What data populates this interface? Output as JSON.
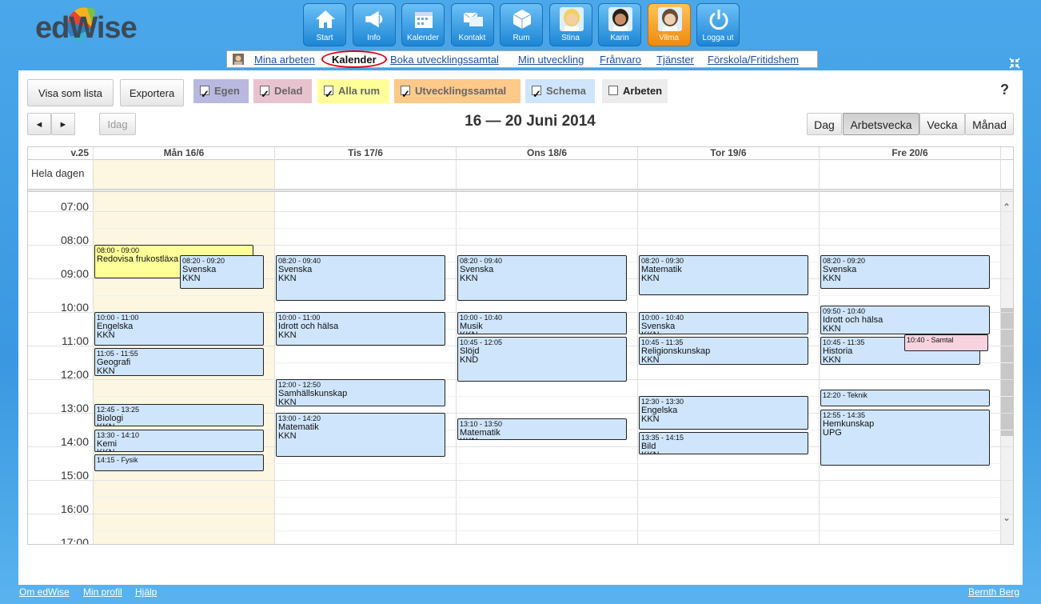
{
  "app": {
    "logo_text": "edWise"
  },
  "nav": {
    "items": [
      {
        "label": "Start",
        "icon": "home-icon"
      },
      {
        "label": "Info",
        "icon": "megaphone-icon"
      },
      {
        "label": "Kalender",
        "icon": "calendar-icon"
      },
      {
        "label": "Kontakt",
        "icon": "mail-icon"
      },
      {
        "label": "Rum",
        "icon": "cube-icon"
      },
      {
        "label": "Stina",
        "icon": "avatar-stina-icon"
      },
      {
        "label": "Karin",
        "icon": "avatar-karin-icon"
      },
      {
        "label": "Vilma",
        "icon": "avatar-vilma-icon",
        "active": true
      },
      {
        "label": "Logga ut",
        "icon": "power-icon"
      }
    ]
  },
  "subnav": {
    "links": [
      "Mina arbeten",
      "Kalender",
      "Boka utvecklingssamtal",
      "Min utveckling",
      "Frånvaro",
      "Tjänster",
      "Förskola/Fritidshem"
    ],
    "active": "Kalender"
  },
  "toolbar": {
    "list_button": "Visa som lista",
    "export_button": "Exportera",
    "help": "?",
    "filters": [
      {
        "label": "Egen",
        "checked": true,
        "color": "#b8b8e0"
      },
      {
        "label": "Delad",
        "checked": true,
        "color": "#e8c3cf"
      },
      {
        "label": "Alla rum",
        "checked": true,
        "color": "#ffff99"
      },
      {
        "label": "Utvecklingssamtal",
        "checked": true,
        "color": "#ffc98a"
      },
      {
        "label": "Schema",
        "checked": true,
        "color": "#cfe5fb"
      },
      {
        "label": "Arbeten",
        "checked": false,
        "color": "#ececec"
      }
    ],
    "prev": "◄",
    "next": "►",
    "today": "Idag",
    "date_title": "16 — 20 Juni 2014",
    "views": [
      "Dag",
      "Arbetsvecka",
      "Vecka",
      "Månad"
    ],
    "active_view": "Arbetsvecka"
  },
  "calendar": {
    "week_label": "v.25",
    "all_day_label": "Hela dagen",
    "days": [
      "Mån 16/6",
      "Tis 17/6",
      "Ons 18/6",
      "Tor 19/6",
      "Fre 20/6"
    ],
    "hours": [
      "07:00",
      "08:00",
      "09:00",
      "10:00",
      "11:00",
      "12:00",
      "13:00",
      "14:00",
      "15:00",
      "16:00",
      "17:00"
    ],
    "events": [
      {
        "day": 0,
        "time": "08:00 - 09:00",
        "title": "Redovisa frukostläxa",
        "room": "",
        "color": "yellow",
        "start": 8.0,
        "end": 9.0
      },
      {
        "day": 0,
        "time": "08:20 - 09:20",
        "title": "Svenska",
        "room": "KKN",
        "color": "blue",
        "start": 8.33,
        "end": 9.33,
        "offset": true
      },
      {
        "day": 0,
        "time": "10:00 - 11:00",
        "title": "Engelska",
        "room": "KKN",
        "color": "blue",
        "start": 10.0,
        "end": 11.0
      },
      {
        "day": 0,
        "time": "11:05 - 11:55",
        "title": "Geografi",
        "room": "KKN",
        "color": "blue",
        "start": 11.08,
        "end": 11.92
      },
      {
        "day": 0,
        "time": "12:45 - 13:25",
        "title": "Biologi",
        "room": "KKN",
        "color": "blue",
        "start": 12.75,
        "end": 13.42
      },
      {
        "day": 0,
        "time": "13:30 - 14:10",
        "title": "Kemi",
        "room": "KKN",
        "color": "blue",
        "start": 13.5,
        "end": 14.17
      },
      {
        "day": 0,
        "time": "14:15 - Fysik",
        "title": "",
        "room": "",
        "color": "blue",
        "start": 14.25,
        "end": 14.75
      },
      {
        "day": 1,
        "time": "08:20 - 09:40",
        "title": "Svenska",
        "room": "KKN",
        "color": "blue",
        "start": 8.33,
        "end": 9.67
      },
      {
        "day": 1,
        "time": "10:00 - 11:00",
        "title": "Idrott och hälsa",
        "room": "KKN",
        "color": "blue",
        "start": 10.0,
        "end": 11.0
      },
      {
        "day": 1,
        "time": "12:00 - 12:50",
        "title": "Samhällskunskap",
        "room": "KKN",
        "color": "blue",
        "start": 12.0,
        "end": 12.83
      },
      {
        "day": 1,
        "time": "13:00 - 14:20",
        "title": "Matematik",
        "room": "KKN",
        "color": "blue",
        "start": 13.0,
        "end": 14.33
      },
      {
        "day": 2,
        "time": "08:20 - 09:40",
        "title": "Svenska",
        "room": "KKN",
        "color": "blue",
        "start": 8.33,
        "end": 9.67
      },
      {
        "day": 2,
        "time": "10:00 - 10:40",
        "title": "Musik",
        "room": "KKN",
        "color": "blue",
        "start": 10.0,
        "end": 10.67
      },
      {
        "day": 2,
        "time": "10:45 - 12:05",
        "title": "Slöjd",
        "room": "KND",
        "color": "blue",
        "start": 10.75,
        "end": 12.08
      },
      {
        "day": 2,
        "time": "13:10 - 13:50",
        "title": "Matematik",
        "room": "KKN",
        "color": "blue",
        "start": 13.17,
        "end": 13.83
      },
      {
        "day": 3,
        "time": "08:20 - 09:30",
        "title": "Matematik",
        "room": "KKN",
        "color": "blue",
        "start": 8.33,
        "end": 9.5
      },
      {
        "day": 3,
        "time": "10:00 - 10:40",
        "title": "Svenska",
        "room": "KKN",
        "color": "blue",
        "start": 10.0,
        "end": 10.67
      },
      {
        "day": 3,
        "time": "10:45 - 11:35",
        "title": "Religionskunskap",
        "room": "KKN",
        "color": "blue",
        "start": 10.75,
        "end": 11.58
      },
      {
        "day": 3,
        "time": "12:30 - 13:30",
        "title": "Engelska",
        "room": "KKN",
        "color": "blue",
        "start": 12.5,
        "end": 13.5
      },
      {
        "day": 3,
        "time": "13:35 - 14:15",
        "title": "Bild",
        "room": "KKN",
        "color": "blue",
        "start": 13.58,
        "end": 14.25
      },
      {
        "day": 4,
        "time": "08:20 - 09:20",
        "title": "Svenska",
        "room": "KKN",
        "color": "blue",
        "start": 8.33,
        "end": 9.33
      },
      {
        "day": 4,
        "time": "09:50 - 10:40",
        "title": "Idrott och hälsa",
        "room": "KKN",
        "color": "blue",
        "start": 9.83,
        "end": 10.67
      },
      {
        "day": 4,
        "time": "10:45 - 11:35",
        "title": "Historia",
        "room": "KKN",
        "color": "blue",
        "start": 10.75,
        "end": 11.58,
        "narrow": true
      },
      {
        "day": 4,
        "time": "10:40 - Samtal",
        "title": "",
        "room": "",
        "color": "pink",
        "start": 10.67,
        "end": 11.17,
        "offset": true
      },
      {
        "day": 4,
        "time": "12:20 - Teknik",
        "title": "",
        "room": "",
        "color": "blue",
        "start": 12.33,
        "end": 12.83
      },
      {
        "day": 4,
        "time": "12:55 - 14:35",
        "title": "Hemkunskap",
        "room": "UPG",
        "color": "blue",
        "start": 12.92,
        "end": 14.58
      }
    ]
  },
  "footer": {
    "links": [
      "Om edWise",
      "Min profil",
      "Hjälp"
    ],
    "user": "Bernth Berg"
  }
}
